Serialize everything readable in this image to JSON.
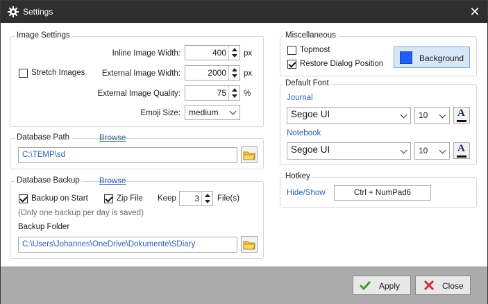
{
  "window": {
    "title": "Settings",
    "close_glyph": "✕"
  },
  "image_settings": {
    "group_label": "Image Settings",
    "stretch_images_label": "Stretch Images",
    "stretch_images_checked": false,
    "inline_width_label": "Inline Image Width:",
    "inline_width_value": "400",
    "inline_width_unit": "px",
    "external_width_label": "External Image Width:",
    "external_width_value": "2000",
    "external_width_unit": "px",
    "external_quality_label": "External Image Quality:",
    "external_quality_value": "75",
    "external_quality_unit": "%",
    "emoji_size_label": "Emoji Size:",
    "emoji_size_value": "medium"
  },
  "database_path": {
    "group_label": "Database Path",
    "browse_label": "Browse",
    "path_value": "C:\\TEMP\\sd"
  },
  "database_backup": {
    "group_label": "Database Backup",
    "browse_label": "Browse",
    "backup_on_start_label": "Backup on Start",
    "backup_on_start_checked": true,
    "zip_file_label": "Zip File",
    "zip_file_checked": true,
    "keep_label": "Keep",
    "keep_value": "3",
    "files_label": "File(s)",
    "note": "(Only one backup per day is saved)",
    "backup_folder_label": "Backup Folder",
    "backup_folder_value": "C:\\Users\\Johannes\\OneDrive\\Dokumente\\SDiary"
  },
  "miscellaneous": {
    "group_label": "Miscellaneous",
    "topmost_label": "Topmost",
    "topmost_checked": false,
    "restore_label": "Restore Dialog Position",
    "restore_checked": true,
    "background_label": "Background",
    "background_color": "#1e5ff5"
  },
  "default_font": {
    "group_label": "Default Font",
    "journal_label": "Journal",
    "journal_font": "Segoe UI",
    "journal_size": "10",
    "notebook_label": "Notebook",
    "notebook_font": "Segoe UI",
    "notebook_size": "10"
  },
  "hotkey": {
    "group_label": "Hotkey",
    "hide_show_label": "Hide/Show",
    "hide_show_value": "Ctrl + NumPad6"
  },
  "footer": {
    "apply_label": "Apply",
    "close_label": "Close"
  },
  "colors": {
    "accent_link": "#2d5fb5",
    "titlebar": "#2f2f2f",
    "footer": "#ababab"
  }
}
